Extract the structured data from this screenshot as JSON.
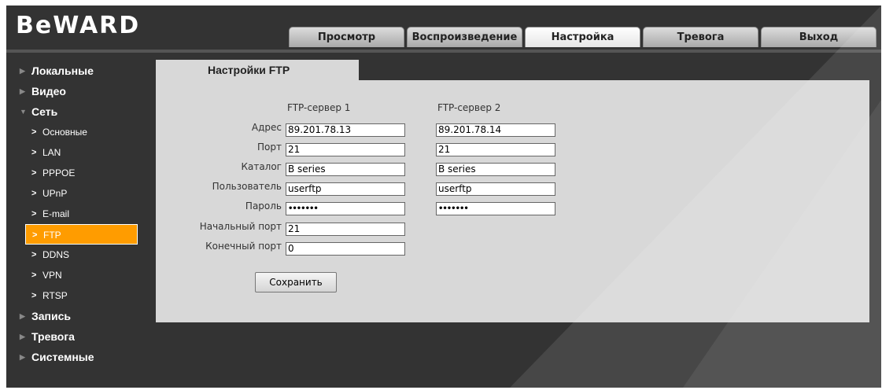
{
  "logo": "BeWARD",
  "tabs": [
    "Просмотр",
    "Воспроизведение",
    "Настройка",
    "Тревога",
    "Выход"
  ],
  "active_tab": "Настройка",
  "sidebar": {
    "main": [
      "Локальные",
      "Видео",
      "Сеть",
      "Запись",
      "Тревога",
      "Системные"
    ],
    "sub": [
      "Основные",
      "LAN",
      "PPPOE",
      "UPnP",
      "E-mail",
      "FTP",
      "DDNS",
      "VPN",
      "RTSP"
    ],
    "active_sub": "FTP"
  },
  "panel": {
    "title": "Настройки FTP",
    "col1": "FTP-сервер 1",
    "col2": "FTP-сервер 2",
    "labels": [
      "Адрес",
      "Порт",
      "Каталог",
      "Пользователь",
      "Пароль",
      "Начальный порт",
      "Конечный порт"
    ],
    "server1": {
      "address": "89.201.78.13",
      "port": "21",
      "dir": "B series",
      "user": "userftp",
      "password": "•••••••"
    },
    "server2": {
      "address": "89.201.78.14",
      "port": "21",
      "dir": "B series",
      "user": "userftp",
      "password": "•••••••"
    },
    "start_port": "21",
    "end_port": "0",
    "save_label": "Сохранить"
  }
}
